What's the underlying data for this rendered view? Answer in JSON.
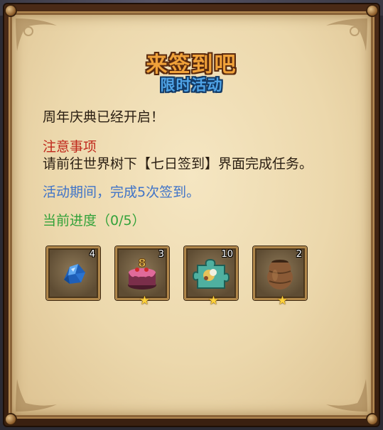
{
  "title": "来签到吧",
  "subtitle": "限时活动",
  "intro": "周年庆典已经开启！",
  "notice": {
    "heading": "注意事项",
    "body": "请前往世界树下【七日签到】界面完成任务。"
  },
  "period_text": "活动期间，完成5次签到。",
  "progress_text": "当前进度（0/5）",
  "rewards": [
    {
      "icon": "blue-crystal-icon",
      "count": "4",
      "starred": false
    },
    {
      "icon": "cake-icon",
      "count": "3",
      "starred": true
    },
    {
      "icon": "puzzle-piece-icon",
      "count": "10",
      "starred": true
    },
    {
      "icon": "clay-pot-icon",
      "count": "2",
      "starred": true
    }
  ],
  "colors": {
    "title": "#f0a23a",
    "subtitle": "#4fa3e6",
    "notice_heading": "#c0281c",
    "period": "#3f73c8",
    "progress": "#33a23a",
    "star": "#ffd23a"
  }
}
